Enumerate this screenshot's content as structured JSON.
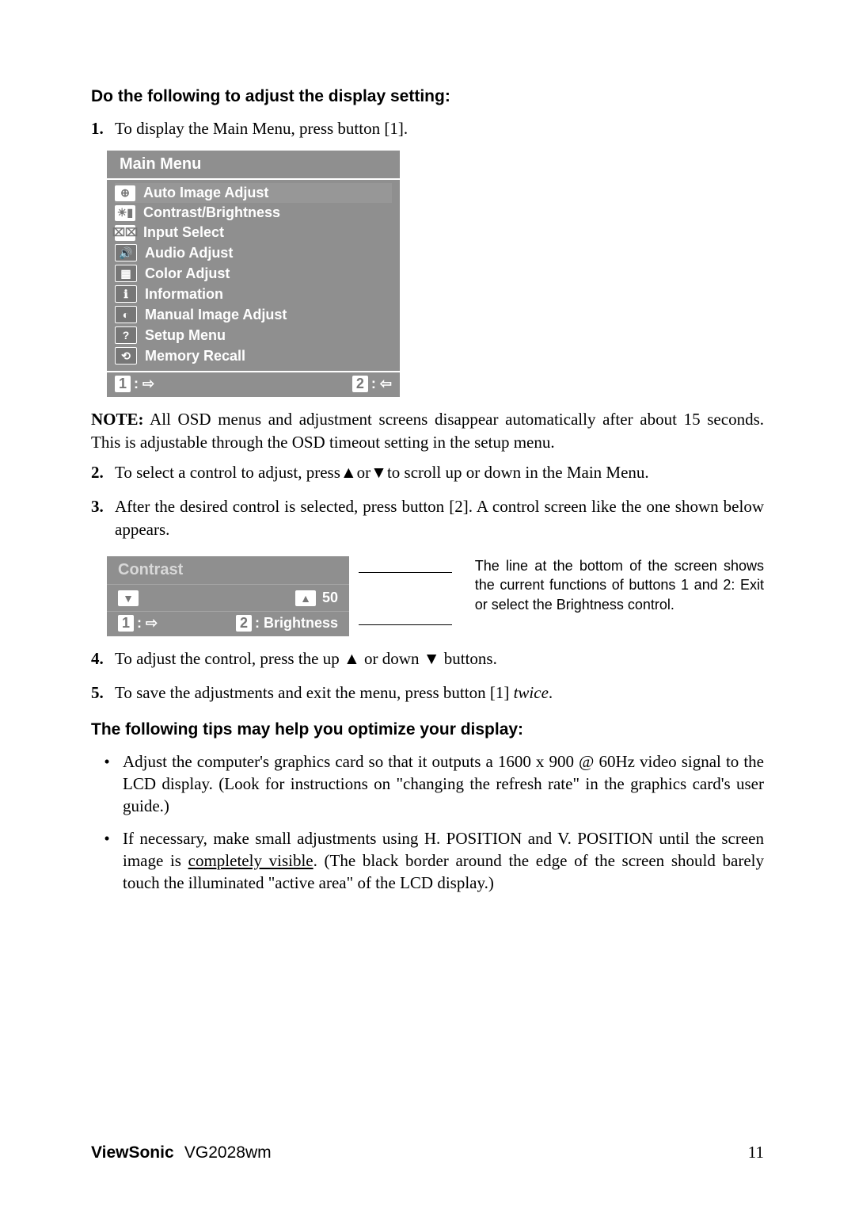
{
  "heading1": "Do the following to adjust the display setting:",
  "step1_num": "1.",
  "step1_body": "To display the Main Menu, press button [1].",
  "osd": {
    "title": "Main Menu",
    "items": [
      {
        "icon": "⊕",
        "label": "Auto Image Adjust"
      },
      {
        "icon": "☀▮",
        "label": "Contrast/Brightness"
      },
      {
        "icon": "⌧⌧",
        "label": "Input Select"
      },
      {
        "icon": "🔊",
        "label": "Audio Adjust"
      },
      {
        "icon": "▦",
        "label": "Color Adjust"
      },
      {
        "icon": "ℹ",
        "label": "Information"
      },
      {
        "icon": "◐",
        "label": "Manual Image Adjust"
      },
      {
        "icon": "?",
        "label": "Setup Menu"
      },
      {
        "icon": "⟲",
        "label": "Memory Recall"
      }
    ],
    "footer_left_key": "1",
    "footer_left_glyph": ": ⇨",
    "footer_right_key": "2",
    "footer_right_glyph": ": ⇦"
  },
  "note_lead": "NOTE:",
  "note_body": " All OSD menus and adjustment screens disappear automatically after about 15 seconds. This is adjustable through the OSD timeout setting in the setup menu.",
  "step2_num": "2.",
  "step2_body_a": "To select a control to adjust, press",
  "step2_body_b": "or",
  "step2_body_c": "to scroll up or down in the Main Menu.",
  "step3_num": "3.",
  "step3_body": "After the desired control is selected, press button [2]. A control screen like the one shown below appears.",
  "contrast": {
    "title": "Contrast",
    "value": "50",
    "footer_left_key": "1",
    "footer_left_glyph": ": ⇨",
    "footer_right_key": "2",
    "footer_right_label": ": Brightness"
  },
  "caption": "The line at the bottom of the screen shows the current functions of buttons 1 and 2: Exit or select the Brightness control.",
  "step4_num": "4.",
  "step4_body_a": "To adjust the control, press the up ",
  "step4_body_b": " or down ",
  "step4_body_c": " buttons.",
  "step5_num": "5.",
  "step5_body_a": "To save the adjustments and exit the menu, press button [1] ",
  "step5_body_b": "twice",
  "step5_body_c": ".",
  "heading2": "The following tips may help you optimize your display:",
  "tip1": "Adjust the computer's graphics card so that it outputs a 1600 x 900 @ 60Hz video signal to the LCD display. (Look for instructions on \"changing the refresh rate\" in the graphics card's user guide.)",
  "tip2_a": "If necessary, make small adjustments using H. POSITION and V. POSITION until the screen image is ",
  "tip2_b": "completely visible",
  "tip2_c": ". (The black border around the edge of the screen should barely touch the illuminated \"active area\" of the LCD display.)",
  "footer_brand": "ViewSonic",
  "footer_model": "VG2028wm",
  "footer_page": "11"
}
